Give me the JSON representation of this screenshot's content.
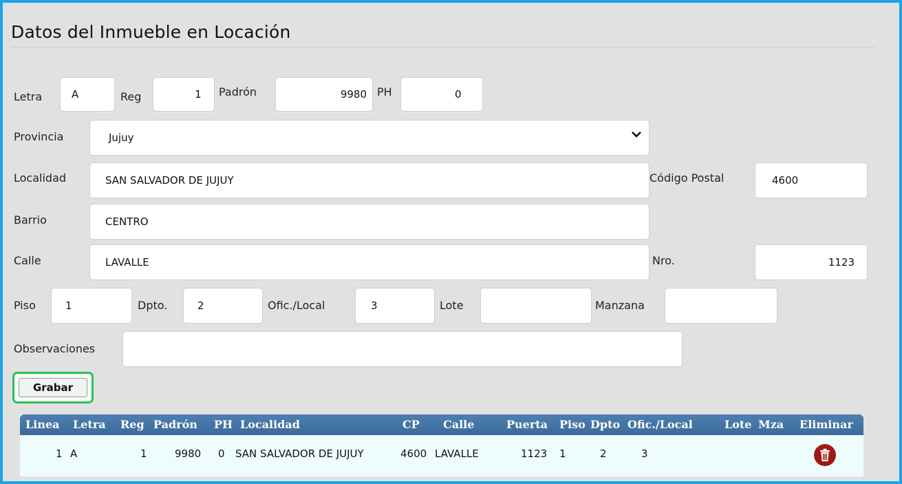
{
  "page": {
    "title": "Datos del Inmueble en Locación"
  },
  "form": {
    "letra": {
      "label": "Letra",
      "value": "A"
    },
    "reg": {
      "label": "Reg",
      "value": "1"
    },
    "padron": {
      "label": "Padrón",
      "value": "9980"
    },
    "ph": {
      "label": "PH",
      "value": "0"
    },
    "provincia": {
      "label": "Provincia",
      "value": "Jujuy"
    },
    "localidad": {
      "label": "Localidad",
      "value": "SAN SALVADOR DE JUJUY"
    },
    "codigo_postal": {
      "label": "Código Postal",
      "value": "4600"
    },
    "barrio": {
      "label": "Barrio",
      "value": "CENTRO"
    },
    "calle": {
      "label": "Calle",
      "value": "LAVALLE"
    },
    "nro": {
      "label": "Nro.",
      "value": "1123"
    },
    "piso": {
      "label": "Piso",
      "value": "1"
    },
    "dpto": {
      "label": "Dpto.",
      "value": "2"
    },
    "oficina": {
      "label": "Ofic./Local",
      "value": "3"
    },
    "lote": {
      "label": "Lote",
      "value": ""
    },
    "manzana": {
      "label": "Manzana",
      "value": ""
    },
    "observaciones": {
      "label": "Observaciones",
      "value": ""
    },
    "save_label": "Grabar"
  },
  "table": {
    "headers": [
      "Linea",
      "Letra",
      "Reg",
      "Padrón",
      "PH",
      "Localidad",
      "CP",
      "Calle",
      "Puerta",
      "Piso",
      "Dpto",
      "Ofic./Local",
      "Lote",
      "Mza",
      "Eliminar"
    ],
    "rows": [
      [
        "1",
        "A",
        "1",
        "9980",
        "0",
        "SAN SALVADOR DE JUJUY",
        "4600",
        "LAVALLE",
        "1123",
        "1",
        "2",
        "3",
        "",
        "",
        ""
      ]
    ]
  },
  "colors": {
    "frame_border": "#1aa6e6",
    "panel_bg": "#e1e1e1",
    "table_header": "#3c6a99",
    "table_row_bg": "#eefcfd",
    "delete_icon": "#a01a14",
    "save_highlight": "#2fbf5a"
  },
  "icons": {
    "select_arrow": "chevron-down-icon",
    "delete": "trash-icon"
  }
}
